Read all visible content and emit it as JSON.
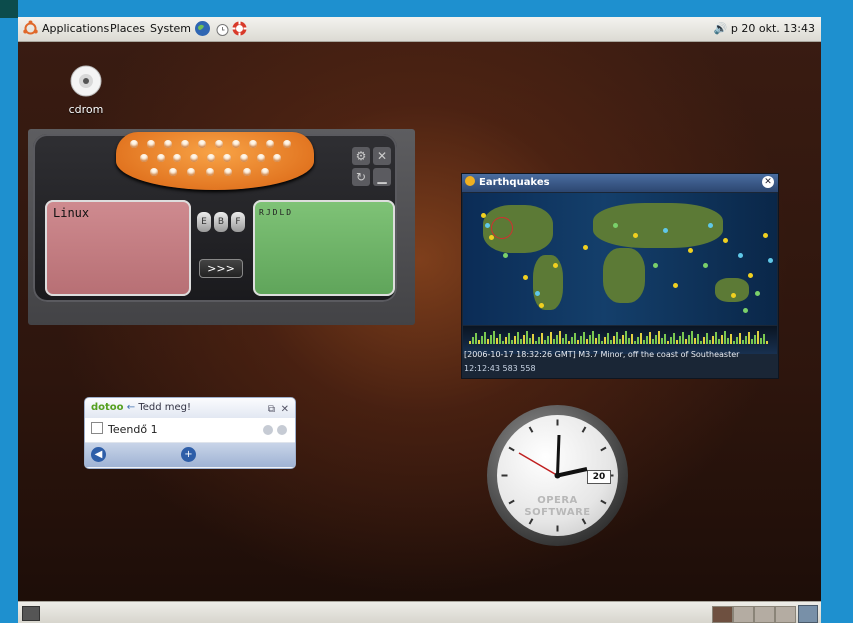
{
  "top_panel": {
    "menus": [
      "Applications",
      "Places",
      "System"
    ],
    "datetime": "p 20 okt. 13:43"
  },
  "desktop": {
    "cdrom_label": "cdrom"
  },
  "translator": {
    "source_text": "Linux",
    "result_text": "RJDLD",
    "lang_buttons": [
      "E",
      "B",
      "F"
    ],
    "go_label": ">>>"
  },
  "earthquakes": {
    "title": "Earthquakes",
    "info": "[2006-10-17 18:32:26 GMT] M3.7 Minor, off the coast of Southeaster",
    "time": "12:12:43 583 558",
    "accent": "#f0d020"
  },
  "dotoo": {
    "brand": "dotoo",
    "title": "Tedd meg!",
    "item": "Teendő 1"
  },
  "clock": {
    "date": "20",
    "brand_line1": "OPERA",
    "brand_line2": "SOFTWARE"
  }
}
